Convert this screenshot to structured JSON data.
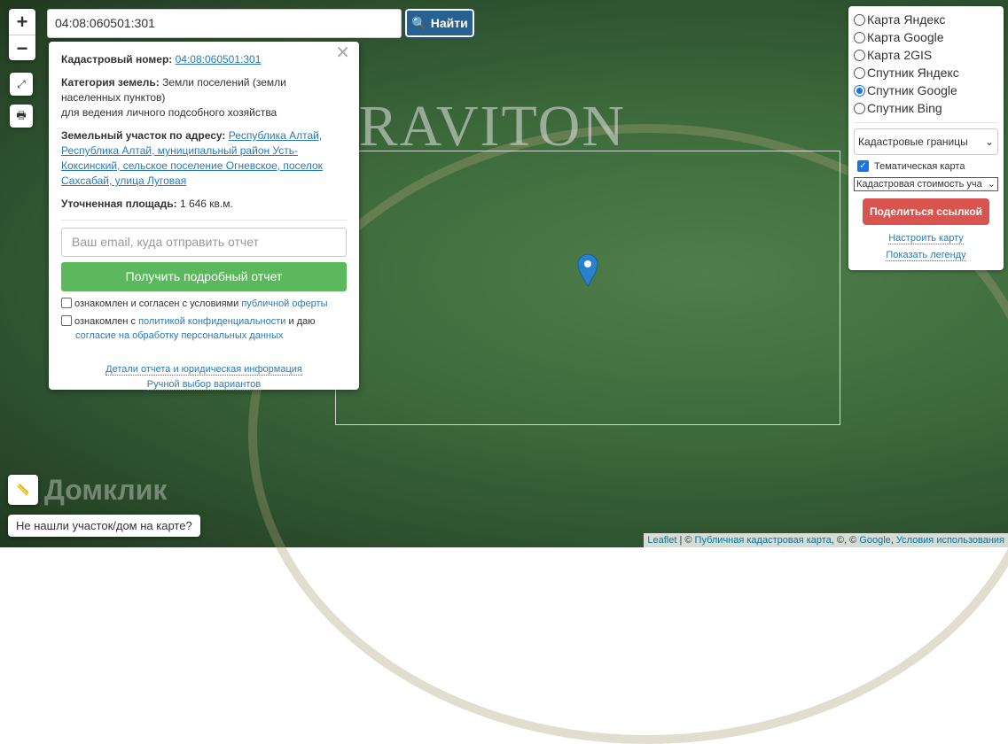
{
  "search": {
    "value": "04:08:060501:301",
    "button": "Найти"
  },
  "zoom": {
    "in": "+",
    "out": "−"
  },
  "popup": {
    "cad_label": "Кадастровый номер:",
    "cad_value": "04:08:060501:301",
    "cat_label": "Категория земель:",
    "cat_value": "Земли поселений (земли населенных пунктов)",
    "cat_use": "для ведения личного подсобного хозяйства",
    "addr_label": "Земельный участок по адресу:",
    "addr_value": "Республика Алтай, Республика Алтай, муниципальный район Усть-Коксинский, сельское поселение Огневское, поселок Сахсабай, улица Луговая",
    "area_label": "Уточненная площадь:",
    "area_value": "1 646 кв.м.",
    "email_placeholder": "Ваш email, куда отправить отчет",
    "report_button": "Получить подробный отчет",
    "chk1_text": "ознакомлен и согласен с условиями ",
    "chk1_link": "публичной оферты",
    "chk2_text": "ознакомлен с ",
    "chk2_link": "политикой конфиденциальности",
    "chk2_text2": " и даю",
    "chk2_link2": "согласие на обработку персональных данных",
    "details_link": "Детали отчета и юридическая информация",
    "manual_link": "Ручной выбор вариантов"
  },
  "layers": {
    "options": [
      "Карта Яндекс",
      "Карта Google",
      "Карта 2GIS",
      "Спутник Яндекс",
      "Спутник Google",
      "Спутник Bing"
    ],
    "selected": "Спутник Google",
    "overlay_select": "Кадастровые границы",
    "thematic_label": "Тематическая карта",
    "thematic_select": "Кадастровая стоимость уча",
    "share_button": "Поделиться ссылкой",
    "configure_link": "Настроить карту",
    "legend_link": "Показать легенду"
  },
  "watermark": "GRAVITON",
  "domclick": "Домклик",
  "not_found": "Не нашли участок/дом на карте?",
  "attribution": {
    "leaflet": "Leaflet",
    "sep": " | © ",
    "pkk": "Публичная кадастровая карта",
    "mid": ", ©, © ",
    "google": "Google",
    "comma": ", ",
    "terms": "Условия использования"
  }
}
